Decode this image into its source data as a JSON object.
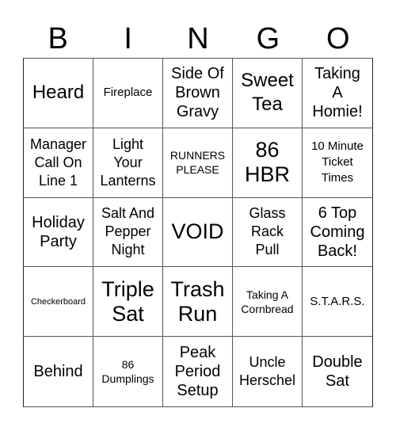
{
  "header": {
    "letters": [
      "B",
      "I",
      "N",
      "G",
      "O"
    ]
  },
  "board": {
    "cells": [
      "Heard",
      "Fireplace",
      "Side Of\nBrown\nGravy",
      "Sweet\nTea",
      "Taking\nA\nHomie!",
      "Manager\nCall On\nLine 1",
      "Light\nYour\nLanterns",
      "RUNNERS\nPLEASE",
      "86\nHBR",
      "10 Minute\nTicket\nTimes",
      "Holiday\nParty",
      "Salt And\nPepper\nNight",
      "VOID",
      "Glass\nRack\nPull",
      "6 Top\nComing\nBack!",
      "Checkerboard",
      "Triple\nSat",
      "Trash\nRun",
      "Taking A\nCornbread",
      "S.T.A.R.S.",
      "Behind",
      "86\nDumplings",
      "Peak\nPeriod\nSetup",
      "Uncle\nHerschel",
      "Double\nSat"
    ]
  }
}
